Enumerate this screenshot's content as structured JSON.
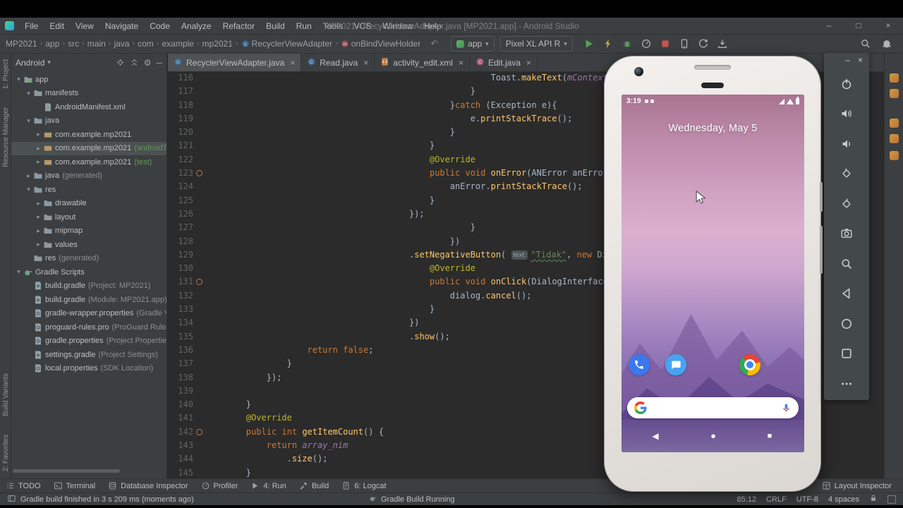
{
  "window": {
    "title": "MP2021 - RecyclerViewAdapter.java [MP2021.app] - Android Studio",
    "controls": [
      {
        "name": "minimize",
        "glyph": "–"
      },
      {
        "name": "maximize",
        "glyph": "□"
      },
      {
        "name": "close",
        "glyph": "×"
      }
    ]
  },
  "menu": [
    "File",
    "Edit",
    "View",
    "Navigate",
    "Code",
    "Analyze",
    "Refactor",
    "Build",
    "Run",
    "Tools",
    "VCS",
    "Window",
    "Help"
  ],
  "navbar": {
    "crumbs": [
      {
        "label": "MP2021"
      },
      {
        "label": "app"
      },
      {
        "label": "src"
      },
      {
        "label": "main"
      },
      {
        "label": "java"
      },
      {
        "label": "com"
      },
      {
        "label": "example"
      },
      {
        "label": "mp2021"
      },
      {
        "label": "RecyclerViewAdapter",
        "icon": "class"
      },
      {
        "label": "onBindViewHolder",
        "icon": "method"
      }
    ],
    "run_config": "app",
    "device": "Pixel XL API R",
    "actions": [
      "run",
      "apply-changes",
      "debug",
      "profile",
      "stop",
      "device-manager",
      "sync-gradle",
      "sdk-manager"
    ],
    "far_actions": [
      "search",
      "bell"
    ]
  },
  "project": {
    "mode": "Android",
    "header_actions": [
      "locate",
      "collapse",
      "settings",
      "hide"
    ],
    "tree": [
      {
        "arrow": "down",
        "icon": "folder-app",
        "label": "app",
        "indent": 0
      },
      {
        "arrow": "down",
        "icon": "folder",
        "label": "manifests",
        "indent": 1
      },
      {
        "arrow": "none",
        "icon": "file-manifest",
        "label": "AndroidManifest.xml",
        "indent": 2
      },
      {
        "arrow": "down",
        "icon": "folder",
        "label": "java",
        "indent": 1
      },
      {
        "arrow": "right",
        "icon": "package",
        "label": "com.example.mp2021",
        "indent": 2
      },
      {
        "arrow": "right",
        "icon": "package",
        "label": "com.example.mp2021",
        "suffix": "(androidTest)",
        "sgreen": true,
        "indent": 2,
        "selected": true
      },
      {
        "arrow": "right",
        "icon": "package",
        "label": "com.example.mp2021",
        "suffix": "(test)",
        "sgreen": true,
        "indent": 2
      },
      {
        "arrow": "right",
        "icon": "folder",
        "label": "java",
        "suffix": "(generated)",
        "indent": 1
      },
      {
        "arrow": "down",
        "icon": "folder",
        "label": "res",
        "indent": 1
      },
      {
        "arrow": "right",
        "icon": "folder",
        "label": "drawable",
        "indent": 2
      },
      {
        "arrow": "right",
        "icon": "folder",
        "label": "layout",
        "indent": 2
      },
      {
        "arrow": "right",
        "icon": "folder",
        "label": "mipmap",
        "indent": 2
      },
      {
        "arrow": "right",
        "icon": "folder",
        "label": "values",
        "indent": 2
      },
      {
        "arrow": "none",
        "icon": "folder",
        "label": "res",
        "suffix": "(generated)",
        "indent": 1
      },
      {
        "arrow": "down",
        "icon": "gradle-root",
        "label": "Gradle Scripts",
        "indent": 0
      },
      {
        "arrow": "none",
        "icon": "file-gradle",
        "label": "build.gradle",
        "suffix": "(Project: MP2021)",
        "indent": 1
      },
      {
        "arrow": "none",
        "icon": "file-gradle",
        "label": "build.gradle",
        "suffix": "(Module: MP2021.app)",
        "indent": 1
      },
      {
        "arrow": "none",
        "icon": "file-props",
        "label": "gradle-wrapper.properties",
        "suffix": "(Gradle Version)",
        "indent": 1
      },
      {
        "arrow": "none",
        "icon": "file-props",
        "label": "proguard-rules.pro",
        "suffix": "(ProGuard Rules for app)",
        "indent": 1
      },
      {
        "arrow": "none",
        "icon": "file-props",
        "label": "gradle.properties",
        "suffix": "(Project Properties)",
        "indent": 1
      },
      {
        "arrow": "none",
        "icon": "file-gradle",
        "label": "settings.gradle",
        "suffix": "(Project Settings)",
        "indent": 1
      },
      {
        "arrow": "none",
        "icon": "file-props",
        "label": "local.properties",
        "suffix": "(SDK Location)",
        "indent": 1
      }
    ]
  },
  "editor": {
    "tabs": [
      {
        "label": "RecyclerViewAdapter.java",
        "icon": "java",
        "active": true
      },
      {
        "label": "Read.java",
        "icon": "java",
        "active": false
      },
      {
        "label": "activity_edit.xml",
        "icon": "xml",
        "active": false
      },
      {
        "label": "Edit.java",
        "icon": "java-pink",
        "active": false
      }
    ],
    "code": [
      {
        "n": 116,
        "i": 56,
        "m": false,
        "s": [
          [
            "Toast",
            "p"
          ],
          [
            ".",
            "p"
          ],
          [
            "makeText",
            "m"
          ],
          [
            "(",
            "p"
          ],
          [
            "mContext",
            "f"
          ],
          [
            ",",
            "p"
          ]
        ]
      },
      {
        "n": 117,
        "i": 52,
        "m": false,
        "s": [
          [
            "}",
            "p"
          ]
        ]
      },
      {
        "n": 118,
        "i": 48,
        "m": false,
        "s": [
          [
            "}",
            "p"
          ],
          [
            "catch",
            "k"
          ],
          [
            " (Exception e){",
            "p"
          ]
        ]
      },
      {
        "n": 119,
        "i": 52,
        "m": false,
        "s": [
          [
            "e.",
            "p"
          ],
          [
            "printStackTrace",
            "m"
          ],
          [
            "();",
            "p"
          ]
        ]
      },
      {
        "n": 120,
        "i": 48,
        "m": false,
        "s": [
          [
            "}",
            "p"
          ]
        ]
      },
      {
        "n": 121,
        "i": 44,
        "m": false,
        "s": [
          [
            "}",
            "p"
          ]
        ]
      },
      {
        "n": 122,
        "i": 44,
        "m": false,
        "s": [
          [
            "@Override",
            "a"
          ]
        ]
      },
      {
        "n": 123,
        "i": 44,
        "m": true,
        "s": [
          [
            "public",
            "k"
          ],
          [
            " ",
            "p"
          ],
          [
            "void",
            "k"
          ],
          [
            " ",
            "p"
          ],
          [
            "onError",
            "m"
          ],
          [
            "(ANError anError) {",
            "p"
          ]
        ]
      },
      {
        "n": 124,
        "i": 48,
        "m": false,
        "s": [
          [
            "anError.",
            "p"
          ],
          [
            "printStackTrace",
            "m"
          ],
          [
            "();",
            "p"
          ]
        ]
      },
      {
        "n": 125,
        "i": 44,
        "m": false,
        "s": [
          [
            "}",
            "p"
          ]
        ]
      },
      {
        "n": 126,
        "i": 40,
        "m": false,
        "s": [
          [
            "});",
            "p"
          ]
        ]
      },
      {
        "n": 127,
        "i": 52,
        "m": false,
        "s": [
          [
            "}",
            "p"
          ]
        ]
      },
      {
        "n": 128,
        "i": 48,
        "m": false,
        "s": [
          [
            "})",
            "p"
          ]
        ]
      },
      {
        "n": 129,
        "i": 40,
        "m": false,
        "s": [
          [
            ".",
            "p"
          ],
          [
            "setNegativeButton",
            "m"
          ],
          [
            "( ",
            "p"
          ],
          [
            "text:",
            "h"
          ],
          [
            "\"Tidak\"",
            "su"
          ],
          [
            ", ",
            "p"
          ],
          [
            "new",
            "k"
          ],
          [
            " DialogInterface.OnCli",
            "p"
          ]
        ]
      },
      {
        "n": 130,
        "i": 44,
        "m": false,
        "s": [
          [
            "@Override",
            "a"
          ]
        ]
      },
      {
        "n": 131,
        "i": 44,
        "m": true,
        "s": [
          [
            "public",
            "k"
          ],
          [
            " ",
            "p"
          ],
          [
            "void",
            "k"
          ],
          [
            " ",
            "p"
          ],
          [
            "onClick",
            "m"
          ],
          [
            "(DialogInterface dialo",
            "p"
          ]
        ]
      },
      {
        "n": 132,
        "i": 48,
        "m": false,
        "s": [
          [
            "dialog.",
            "p"
          ],
          [
            "cancel",
            "m"
          ],
          [
            "();",
            "p"
          ]
        ]
      },
      {
        "n": 133,
        "i": 44,
        "m": false,
        "s": [
          [
            "}",
            "p"
          ]
        ]
      },
      {
        "n": 134,
        "i": 40,
        "m": false,
        "s": [
          [
            "})",
            "p"
          ]
        ]
      },
      {
        "n": 135,
        "i": 40,
        "m": false,
        "s": [
          [
            ".",
            "p"
          ],
          [
            "show",
            "m"
          ],
          [
            "();",
            "p"
          ]
        ]
      },
      {
        "n": 136,
        "i": 20,
        "m": false,
        "s": [
          [
            "return",
            "k"
          ],
          [
            " ",
            "p"
          ],
          [
            "false",
            "k"
          ],
          [
            ";",
            "p"
          ]
        ]
      },
      {
        "n": 137,
        "i": 16,
        "m": false,
        "s": [
          [
            "}",
            "p"
          ]
        ]
      },
      {
        "n": 138,
        "i": 12,
        "m": false,
        "s": [
          [
            "});",
            "p"
          ]
        ]
      },
      {
        "n": 139,
        "i": 0,
        "m": false,
        "s": []
      },
      {
        "n": 140,
        "i": 8,
        "m": false,
        "s": [
          [
            "}",
            "p"
          ]
        ]
      },
      {
        "n": 141,
        "i": 8,
        "m": false,
        "s": [
          [
            "@Override",
            "a"
          ]
        ]
      },
      {
        "n": 142,
        "i": 8,
        "m": true,
        "s": [
          [
            "public",
            "k"
          ],
          [
            " ",
            "p"
          ],
          [
            "int",
            "k"
          ],
          [
            " ",
            "p"
          ],
          [
            "getItemCount",
            "m"
          ],
          [
            "() {",
            "p"
          ]
        ]
      },
      {
        "n": 143,
        "i": 12,
        "m": false,
        "s": [
          [
            "return",
            "k"
          ],
          [
            " ",
            "p"
          ],
          [
            "array_nim",
            "f"
          ]
        ]
      },
      {
        "n": 144,
        "i": 16,
        "m": false,
        "s": [
          [
            ".",
            "p"
          ],
          [
            "size",
            "m"
          ],
          [
            "();",
            "p"
          ]
        ]
      },
      {
        "n": 145,
        "i": 8,
        "m": false,
        "s": [
          [
            "}",
            "p"
          ]
        ]
      }
    ]
  },
  "left_stripe": {
    "top": [
      "1: Project",
      "Resource Manager"
    ],
    "bottom": [
      "Build Variants",
      "2: Favorites"
    ]
  },
  "right_stripe_icons": 5,
  "tool_windows": {
    "left": [
      {
        "label": "TODO",
        "icon": "todo"
      },
      {
        "label": "Terminal",
        "icon": "terminal"
      },
      {
        "label": "Database Inspector",
        "icon": "database"
      },
      {
        "label": "Profiler",
        "icon": "profiler"
      },
      {
        "label": "4: Run",
        "icon": "run-tool"
      },
      {
        "label": "Build",
        "icon": "build"
      },
      {
        "label": "6: Logcat",
        "icon": "logcat"
      }
    ],
    "right": [
      {
        "label": "Layout Inspector",
        "icon": "layout-inspector"
      }
    ]
  },
  "status_bar": {
    "message": "Gradle build finished in 3 s 209 ms (moments ago)",
    "task": "Gradle Build Running",
    "position": "85:12",
    "line_sep": "CRLF",
    "encoding": "UTF-8",
    "indent": "4 spaces"
  },
  "emulator": {
    "controls": [
      {
        "name": "minimize",
        "glyph": "–"
      },
      {
        "name": "close",
        "glyph": "×"
      }
    ],
    "buttons": [
      "power",
      "volume-up",
      "volume-down",
      "rotate-left",
      "rotate-right",
      "camera",
      "zoom",
      "back",
      "home",
      "overview",
      "more"
    ],
    "phone": {
      "time": "3:19",
      "date": "Wednesday, May 5",
      "dock": [
        "phone-app",
        "messages-app",
        "chrome-app"
      ],
      "nav": [
        {
          "name": "back",
          "glyph": "◀"
        },
        {
          "name": "home",
          "glyph": "●"
        },
        {
          "name": "recents",
          "glyph": "■"
        }
      ]
    }
  },
  "colors": {
    "editor_bg": "#2B2B2B",
    "panel_bg": "#3C3F41",
    "keyword": "#CC7832",
    "string": "#6A8759",
    "annotation": "#BBB529",
    "method": "#FFC66D",
    "field": "#9876AA",
    "plain": "#A9B7C6",
    "line_number": "#606366",
    "run_green": "#5B9C5B",
    "stop_red": "#C75450",
    "selection": "#4B5052"
  }
}
